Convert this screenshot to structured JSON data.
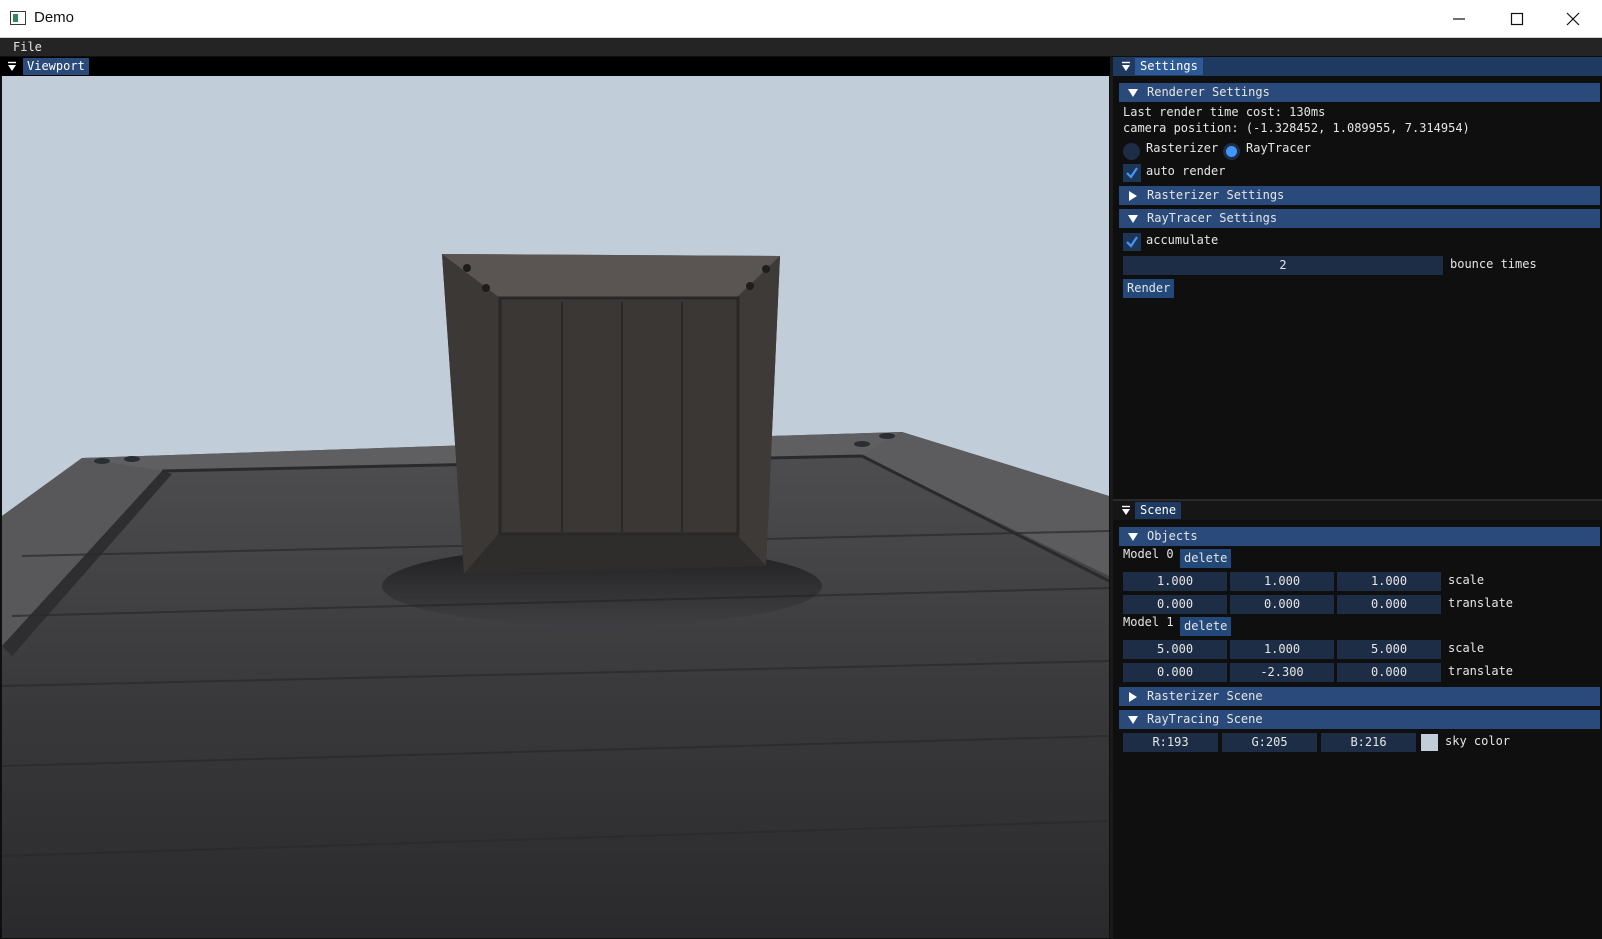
{
  "window": {
    "title": "Demo"
  },
  "menu": {
    "file": "File"
  },
  "viewport": {
    "tab": "Viewport"
  },
  "settings": {
    "tab": "Settings",
    "renderer_header": "Renderer Settings",
    "render_time": "Last render time cost: 130ms",
    "camera_position": "camera position: (-1.328452, 1.089955, 7.314954)",
    "radio_rasterizer": "Rasterizer",
    "radio_raytracer": "RayTracer",
    "selected_renderer": "RayTracer",
    "auto_render_label": "auto render",
    "auto_render_checked": true,
    "rasterizer_header": "Rasterizer Settings",
    "raytracer_header": "RayTracer Settings",
    "accumulate_label": "accumulate",
    "accumulate_checked": true,
    "bounce_value": "2",
    "bounce_label": "bounce times",
    "render_button": "Render"
  },
  "scene": {
    "tab": "Scene",
    "objects_header": "Objects",
    "models": [
      {
        "label": "Model 0",
        "delete": "delete",
        "scale": [
          "1.000",
          "1.000",
          "1.000"
        ],
        "scale_label": "scale",
        "translate": [
          "0.000",
          "0.000",
          "0.000"
        ],
        "translate_label": "translate"
      },
      {
        "label": "Model 1",
        "delete": "delete",
        "scale": [
          "5.000",
          "1.000",
          "5.000"
        ],
        "scale_label": "scale",
        "translate": [
          "0.000",
          "-2.300",
          "0.000"
        ],
        "translate_label": "translate"
      }
    ],
    "rasterizer_scene_header": "Rasterizer Scene",
    "raytracing_scene_header": "RayTracing Scene",
    "sky": {
      "r": "R:193",
      "g": "G:205",
      "b": "B:216",
      "label": "sky color",
      "color": "#c1cdd8"
    }
  },
  "colors": {
    "accent": "#294a7a",
    "field": "#1d2d46",
    "radio_on": "#4296fa",
    "panel_bg": "#0f0f0f"
  }
}
